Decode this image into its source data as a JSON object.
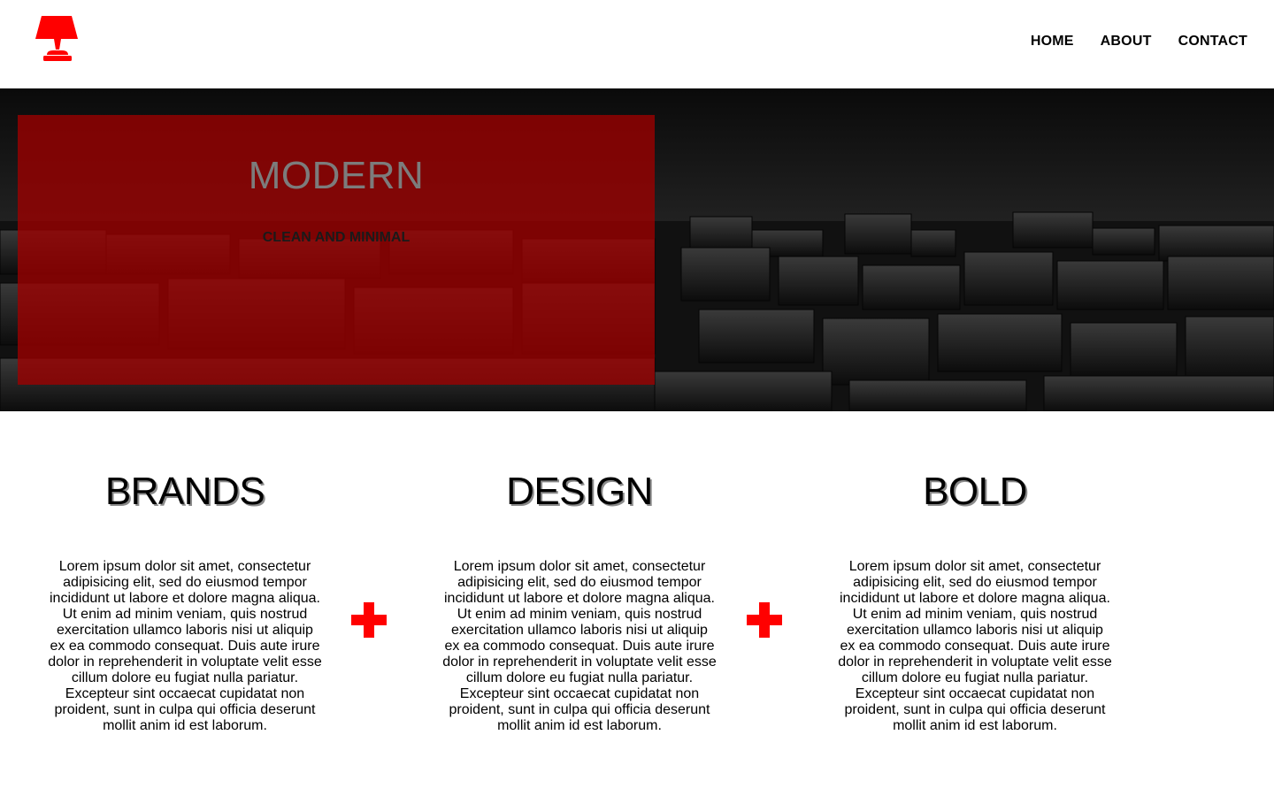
{
  "header": {
    "logo": {
      "icon": "lamp-icon",
      "color": "#ff0000"
    },
    "nav": [
      {
        "label": "HOME"
      },
      {
        "label": "ABOUT"
      },
      {
        "label": "CONTACT"
      }
    ]
  },
  "hero": {
    "title": "MODERN",
    "subtitle": "CLEAN AND MINIMAL",
    "overlay_color": "#9e0000"
  },
  "features": [
    {
      "title": "BRANDS",
      "text": "Lorem ipsum dolor sit amet, consectetur adipisicing elit, sed do eiusmod tempor incididunt ut labore et dolore magna aliqua. Ut enim ad minim veniam, quis nostrud exercitation ullamco laboris nisi ut aliquip ex ea commodo consequat. Duis aute irure dolor in reprehenderit in voluptate velit esse cillum dolore eu fugiat nulla pariatur. Excepteur sint occaecat cupidatat non proident, sunt in culpa qui officia deserunt mollit anim id est laborum."
    },
    {
      "title": "DESIGN",
      "text": "Lorem ipsum dolor sit amet, consectetur adipisicing elit, sed do eiusmod tempor incididunt ut labore et dolore magna aliqua. Ut enim ad minim veniam, quis nostrud exercitation ullamco laboris nisi ut aliquip ex ea commodo consequat. Duis aute irure dolor in reprehenderit in voluptate velit esse cillum dolore eu fugiat nulla pariatur. Excepteur sint occaecat cupidatat non proident, sunt in culpa qui officia deserunt mollit anim id est laborum."
    },
    {
      "title": "BOLD",
      "text": "Lorem ipsum dolor sit amet, consectetur adipisicing elit, sed do eiusmod tempor incididunt ut labore et dolore magna aliqua. Ut enim ad minim veniam, quis nostrud exercitation ullamco laboris nisi ut aliquip ex ea commodo consequat. Duis aute irure dolor in reprehenderit in voluptate velit esse cillum dolore eu fugiat nulla pariatur. Excepteur sint occaecat cupidatat non proident, sunt in culpa qui officia deserunt mollit anim id est laborum."
    }
  ],
  "separator": {
    "icon": "plus-icon",
    "color": "#ff0000"
  }
}
